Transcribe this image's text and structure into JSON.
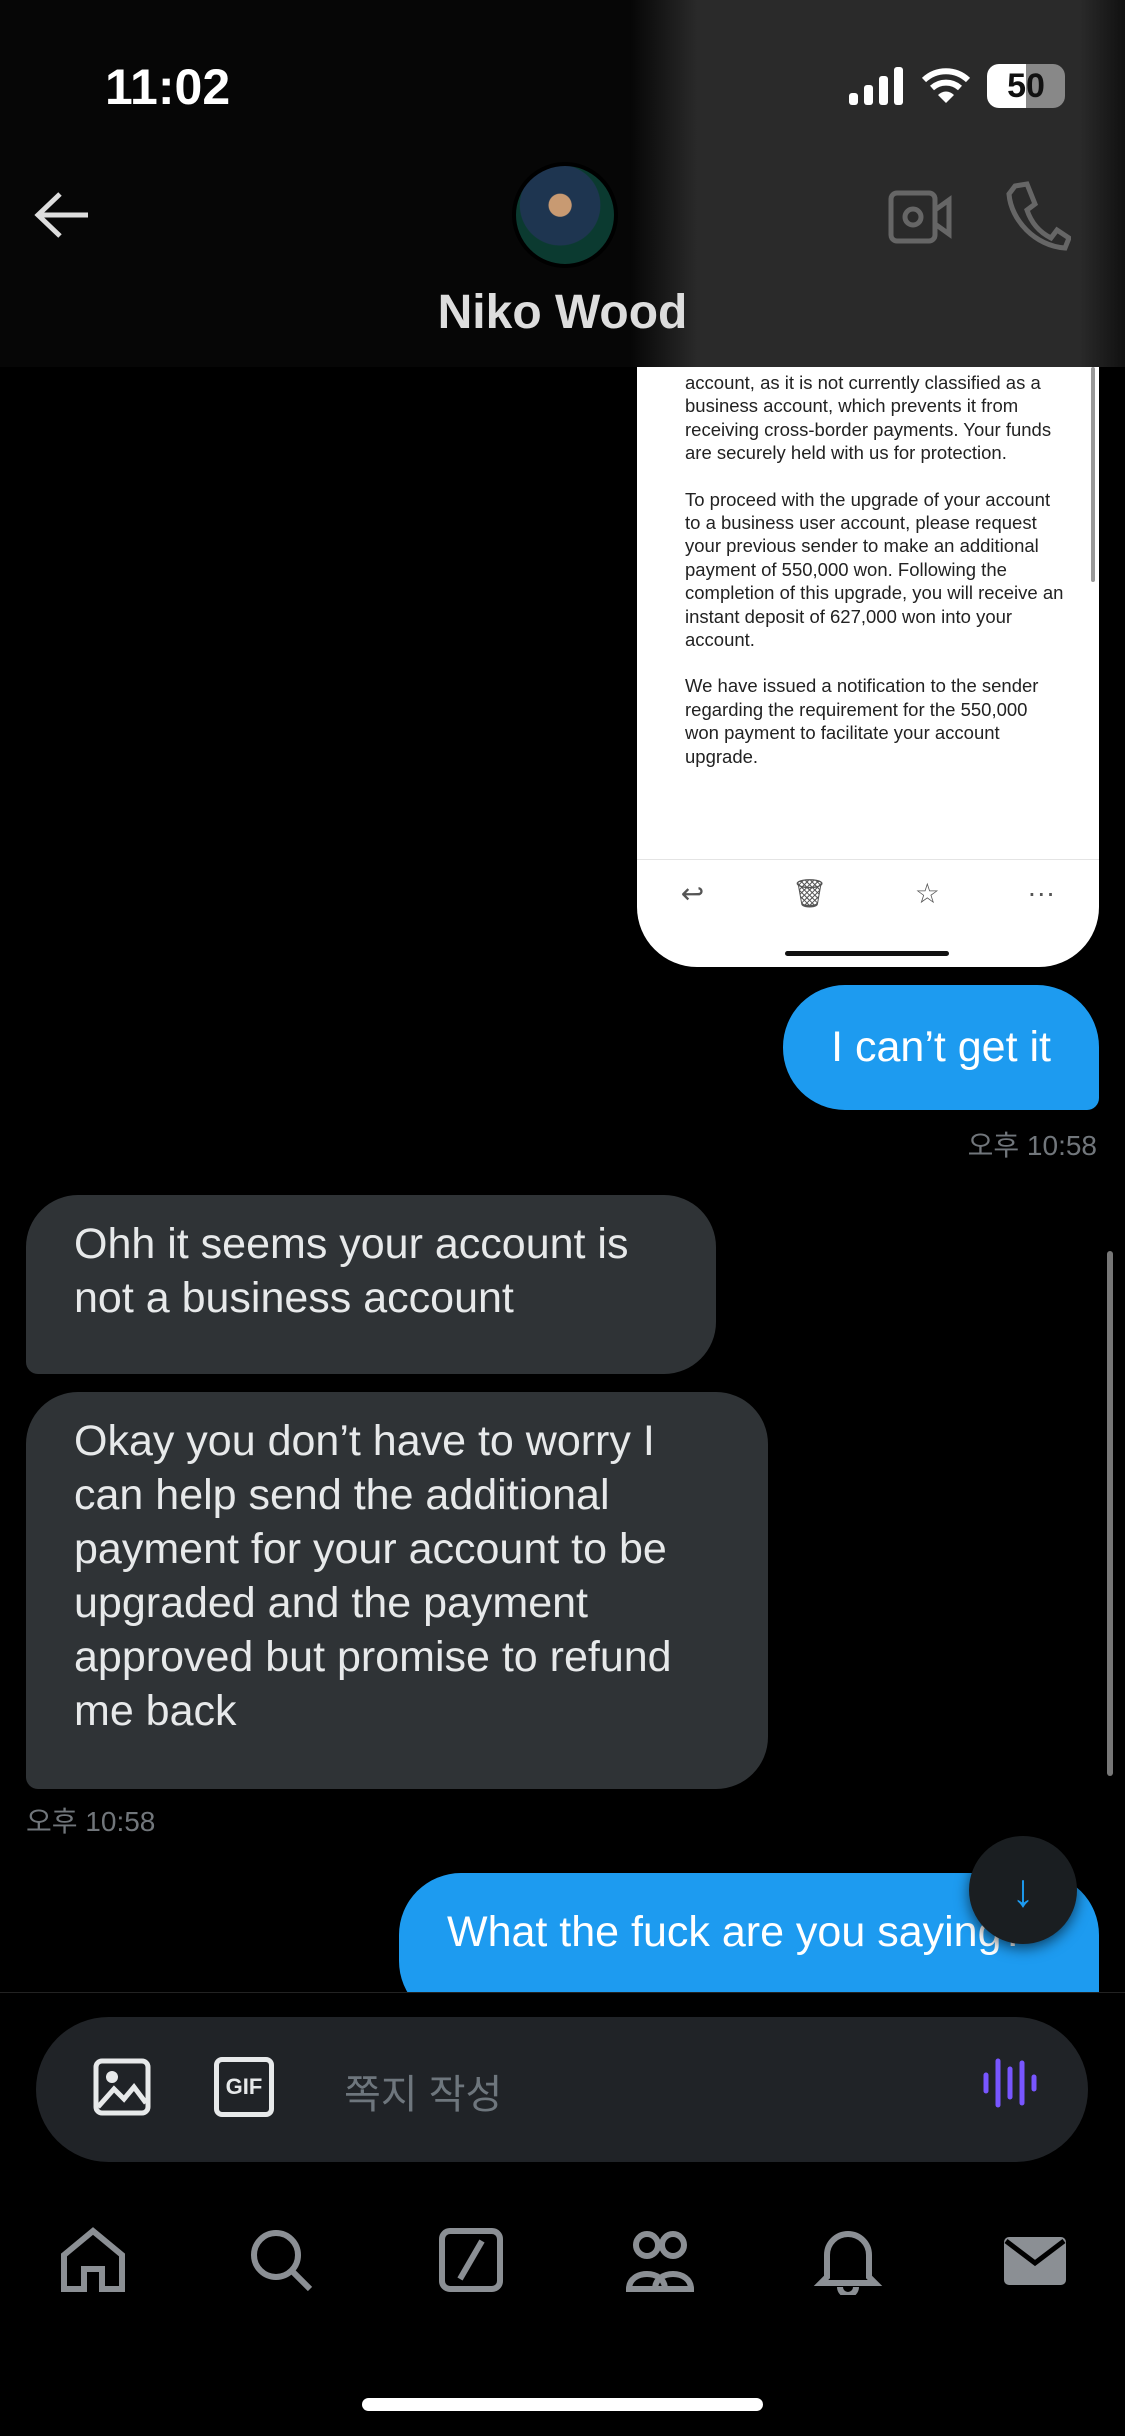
{
  "status_bar": {
    "time": "11:02",
    "battery": "50"
  },
  "header": {
    "contact_name": "Niko Wood"
  },
  "email_image": {
    "paragraphs": [
      "account, as it is not currently classified as a business account, which prevents it from receiving cross-border payments. Your funds are securely held with us for protection.",
      "To proceed with the upgrade of your account to a business user account, please request your previous sender to make an additional payment of 550,000 won. Following the completion of this upgrade, you will receive an instant deposit of 627,000 won into your account.",
      "We have issued a notification to the sender regarding the requirement for the 550,000 won payment to facilitate your account upgrade."
    ]
  },
  "messages": [
    {
      "text": "I can’t get it",
      "from": "me"
    },
    {
      "text": "Ohh it seems your account is not a business account",
      "from": "them"
    },
    {
      "text": "Okay you don’t have to worry I can help send the additional payment for your account to be upgraded and the payment approved but promise to refund me back",
      "from": "them"
    },
    {
      "text": "What the fuck are you saying?",
      "from": "me"
    }
  ],
  "timestamps": {
    "sent": "오후 10:58",
    "received": "오후 10:58"
  },
  "composer": {
    "placeholder": "쪽지 작성",
    "gif_label": "GIF"
  },
  "colors": {
    "accent": "#1d9bf0",
    "received_bubble": "#2f3336",
    "voice": "#7856ff"
  }
}
